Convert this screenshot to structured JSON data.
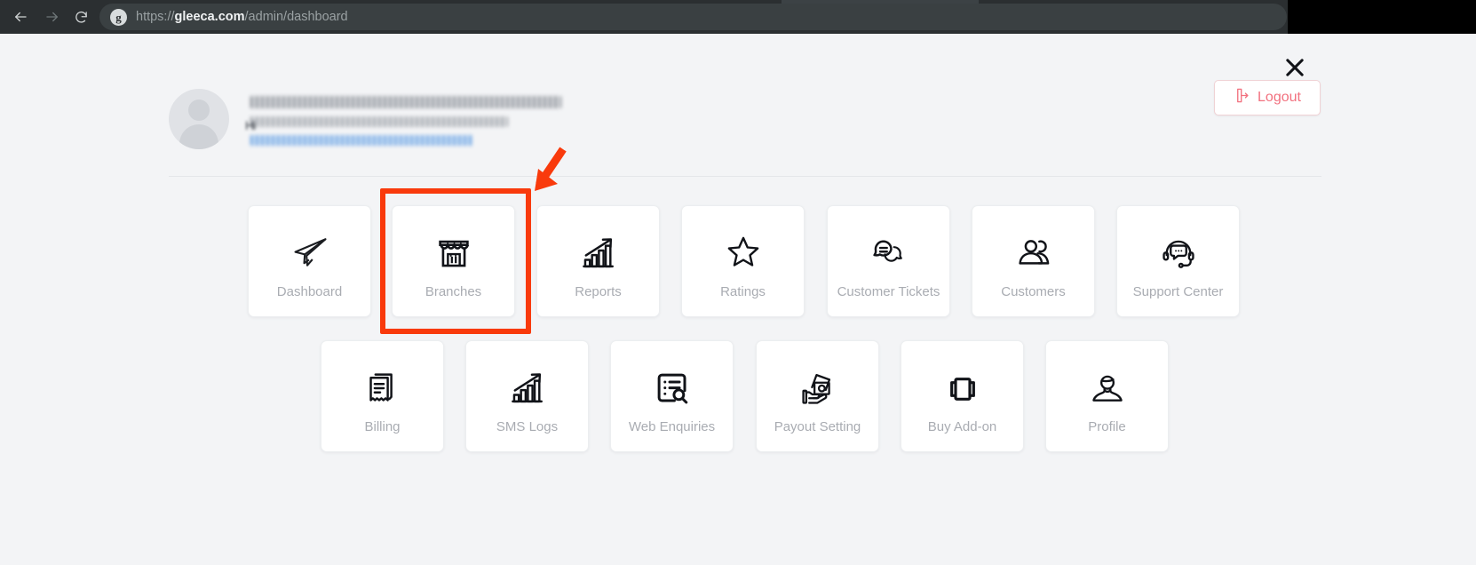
{
  "browser": {
    "url_scheme": "https://",
    "url_host": "gleeca.com",
    "url_path": "/admin/dashboard",
    "site_badge_letter": "g",
    "back_icon": "arrow-left-icon",
    "forward_icon": "arrow-right-icon",
    "reload_icon": "reload-icon"
  },
  "page": {
    "close_label": "✕",
    "logout_label": "Logout",
    "profile": {
      "greeting_prefix": "Hi",
      "name_redacted": true,
      "detail_redacted": true,
      "link_redacted": true
    }
  },
  "tiles": {
    "row1": [
      {
        "label": "Dashboard",
        "icon": "paper-plane-icon"
      },
      {
        "label": "Branches",
        "icon": "storefront-icon",
        "highlighted": true
      },
      {
        "label": "Reports",
        "icon": "bar-chart-growth-icon"
      },
      {
        "label": "Ratings",
        "icon": "star-icon"
      },
      {
        "label": "Customer Tickets",
        "icon": "chat-bubbles-icon"
      },
      {
        "label": "Customers",
        "icon": "users-icon"
      },
      {
        "label": "Support Center",
        "icon": "headset-chat-icon"
      }
    ],
    "row2": [
      {
        "label": "Billing",
        "icon": "receipt-icon"
      },
      {
        "label": "SMS Logs",
        "icon": "bar-chart-growth-icon"
      },
      {
        "label": "Web Enquiries",
        "icon": "list-search-icon"
      },
      {
        "label": "Payout Setting",
        "icon": "cash-hand-icon"
      },
      {
        "label": "Buy Add-on",
        "icon": "addon-box-icon"
      },
      {
        "label": "Profile",
        "icon": "person-icon"
      }
    ]
  },
  "annotation": {
    "highlight_color": "#f93a0c",
    "arrow_target": "Branches",
    "arrow_direction": "down-left"
  }
}
